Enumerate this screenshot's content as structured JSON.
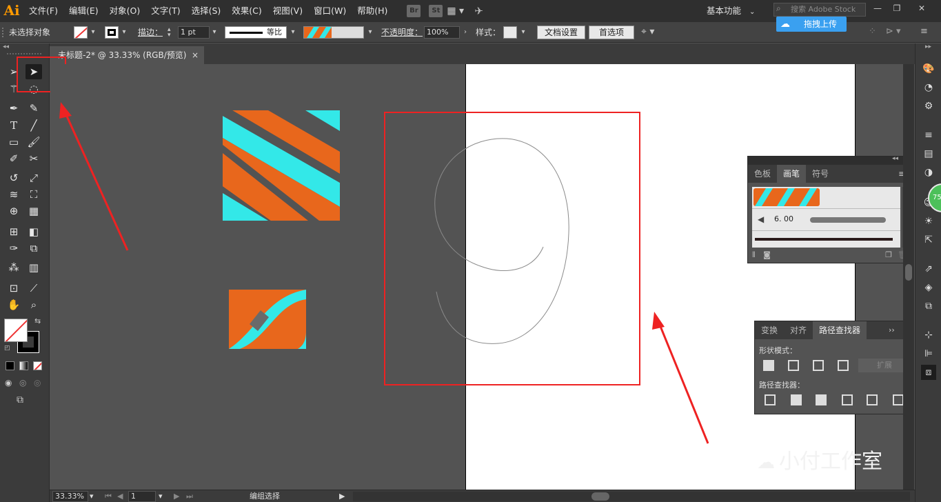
{
  "app": {
    "logo": "Ai"
  },
  "menu": [
    "文件(F)",
    "编辑(E)",
    "对象(O)",
    "文字(T)",
    "选择(S)",
    "效果(C)",
    "视图(V)",
    "窗口(W)",
    "帮助(H)"
  ],
  "menubar_icons": {
    "br": "Br",
    "st": "St"
  },
  "workspace": {
    "label": "基本功能"
  },
  "search": {
    "placeholder": "搜索 Adobe Stock"
  },
  "upload": {
    "label": "拖拽上传"
  },
  "control": {
    "selection_label": "未选择对象",
    "stroke_label": "描边：",
    "stroke_weight": "1 pt",
    "profile_label": "等比",
    "opacity_label": "不透明度：",
    "opacity_value": "100%",
    "style_label": "样式：",
    "doc_setup": "文档设置",
    "preferences": "首选项"
  },
  "document": {
    "tab_title": "未标题-2* @ 33.33% (RGB/预览)",
    "close": "×"
  },
  "brushes_panel": {
    "tabs": [
      "色板",
      "画笔",
      "符号"
    ],
    "active_tab": 1,
    "brush_size": "6. 00"
  },
  "pathfinder_panel": {
    "tabs": [
      "变换",
      "对齐",
      "路径查找器"
    ],
    "active_tab": 2,
    "shape_modes_label": "形状模式：",
    "expand_label": "扩展",
    "pathfinders_label": "路径查找器："
  },
  "status": {
    "zoom": "33.33%",
    "artboard": "1",
    "tool": "编组选择"
  },
  "side_badge": "75",
  "watermark": "小付工作室",
  "colors": {
    "orange": "#e8671c",
    "cyan": "#33e8e8",
    "annotation": "#ee2222",
    "upload": "#3aa0f0"
  },
  "icons": [
    "selection-icon",
    "direct-selection-icon",
    "magic-wand-icon",
    "lasso-icon",
    "pen-icon",
    "curvature-icon",
    "type-icon",
    "line-icon",
    "rectangle-icon",
    "paintbrush-icon",
    "shaper-icon",
    "scissors-icon",
    "rotate-icon",
    "scale-icon",
    "warp-icon",
    "free-transform-icon",
    "shape-builder-icon",
    "perspective-icon",
    "mesh-icon",
    "gradient-icon",
    "eyedropper-icon",
    "blend-icon",
    "symbol-sprayer-icon",
    "graph-icon",
    "artboard-icon",
    "slice-icon",
    "hand-icon",
    "zoom-icon"
  ]
}
